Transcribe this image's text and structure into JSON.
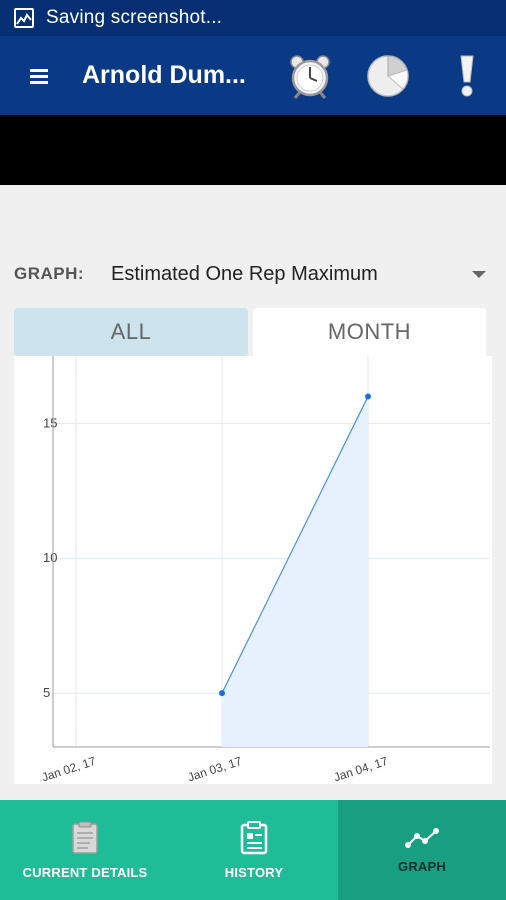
{
  "status_bar": {
    "text": "Saving screenshot..."
  },
  "app_bar": {
    "title": "Arnold Dum...",
    "actions": [
      {
        "name": "alarm-clock-icon"
      },
      {
        "name": "pie-chart-icon"
      },
      {
        "name": "exclamation-icon"
      }
    ]
  },
  "graph_selector": {
    "label": "GRAPH:",
    "selected": "Estimated One Rep Maximum"
  },
  "tabs": [
    {
      "label": "ALL",
      "selected": true
    },
    {
      "label": "MONTH",
      "selected": false
    }
  ],
  "chart_data": {
    "type": "area",
    "x": [
      "Jan 03, 17",
      "Jan 04, 17"
    ],
    "values": [
      5,
      16
    ],
    "x_ticks": [
      "Jan 02, 17",
      "Jan 03, 17",
      "Jan 04, 17"
    ],
    "y_ticks": [
      5,
      10,
      15
    ],
    "ylim": [
      3,
      17.5
    ],
    "grid": true,
    "colors": {
      "line": "#4a8fe8",
      "fill": "#e6f1fd",
      "grid": "#dfe7f4",
      "axis": "#9e9e9e"
    }
  },
  "bottom_nav": [
    {
      "label": "CURRENT DETAILS",
      "icon": "clipboard-icon",
      "active": false
    },
    {
      "label": "HISTORY",
      "icon": "document-icon",
      "active": false
    },
    {
      "label": "GRAPH",
      "icon": "line-graph-icon",
      "active": true
    }
  ],
  "colors": {
    "status_bar": "#062e73",
    "app_bar": "#0a3a86",
    "accent_teal": "#1fbc98",
    "accent_teal_active": "#189e80"
  }
}
